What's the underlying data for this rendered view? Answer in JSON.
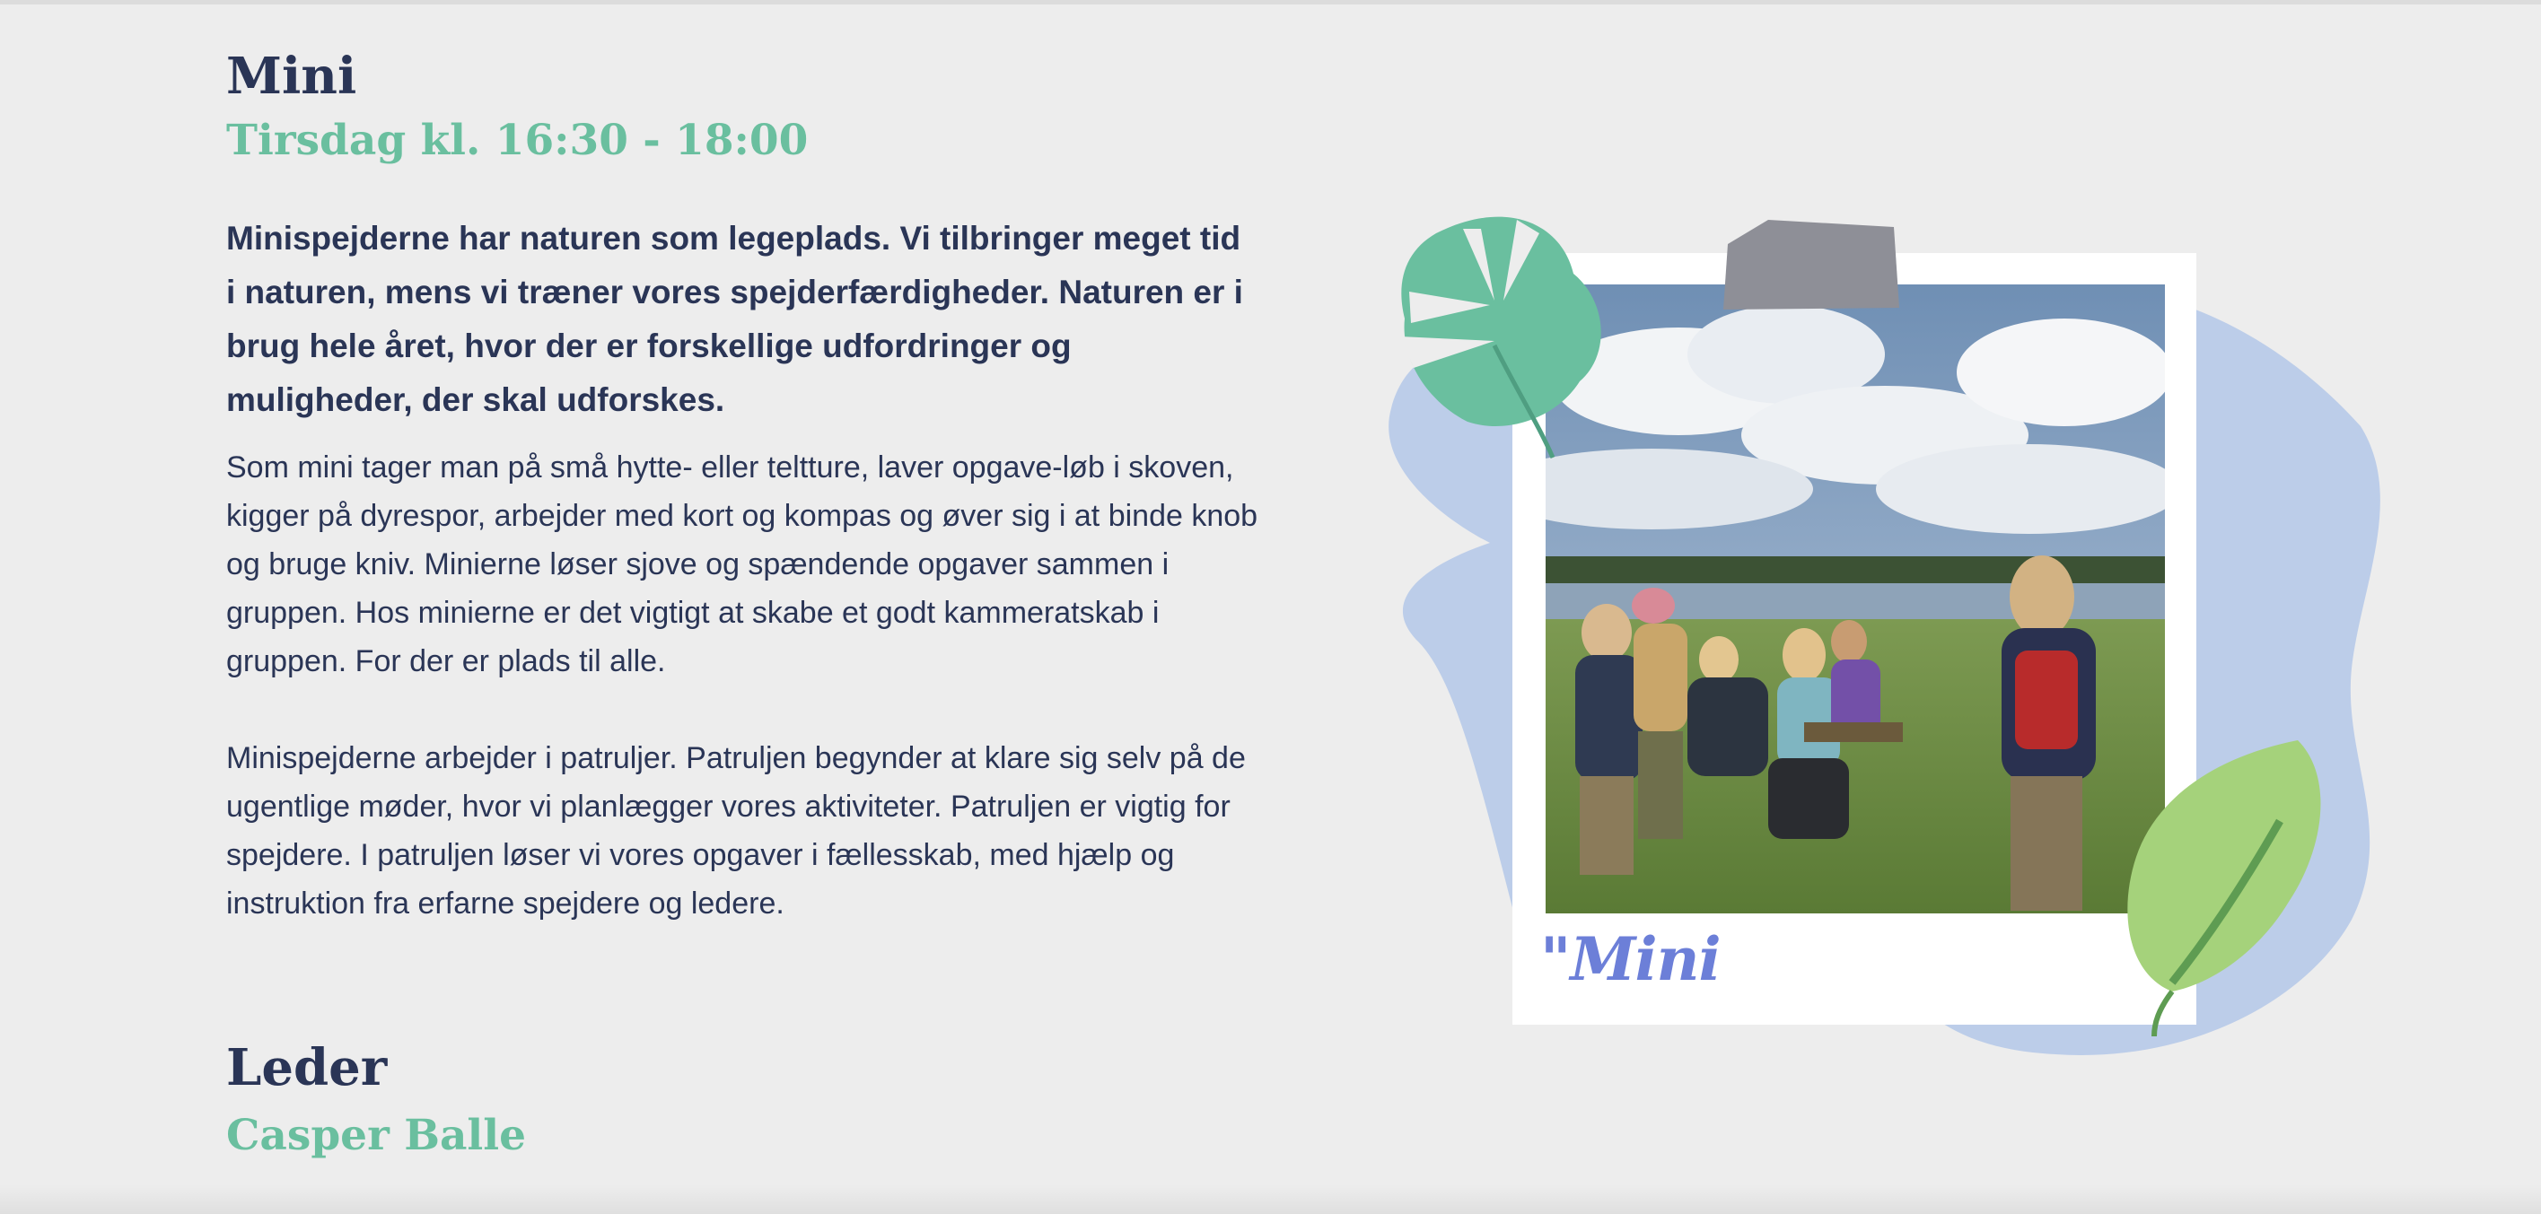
{
  "section": {
    "title": "Mini",
    "schedule": "Tirsdag kl. 16:30 - 18:00",
    "lead": "Minispejderne har naturen som legeplads. Vi tilbringer meget tid i naturen, mens vi træner vores spejderfærdigheder. Naturen er i brug hele året, hvor der er forskellige udfordringer og muligheder, der skal udforskes.",
    "paragraph1": "Som mini tager man på små hytte- eller teltture, laver opgave-løb i skoven, kigger på dyrespor, arbejder med kort og kompas og øver sig i at binde knob og bruge kniv. Minierne løser sjove og spændende opgaver sammen i gruppen. Hos minierne er det vigtigt at skabe et godt kammeratskab i gruppen. For der er plads til alle.",
    "paragraph2": "Minispejderne arbejder i patruljer. Patruljen begynder at klare sig selv på de ugentlige møder, hvor vi planlægger vores aktiviteter. Patruljen er vigtig for spejdere. I patruljen løser vi vores opgaver i fællesskab, med hjælp og instruktion fra erfarne spejdere og ledere."
  },
  "leader": {
    "heading": "Leder",
    "name": "Casper Balle"
  },
  "photo": {
    "caption": "\"Mini",
    "decorations": [
      "blue-blob",
      "monstera-leaf-icon",
      "green-leaf-icon",
      "tape-strip"
    ]
  },
  "colors": {
    "background": "#ededed",
    "heading": "#2a3556",
    "accent_green": "#6abf9f",
    "blob_blue": "#bccde9",
    "caption_purple": "#6c7fd8",
    "leaf_light": "#a5d27b",
    "tape": "#8e8f97"
  }
}
